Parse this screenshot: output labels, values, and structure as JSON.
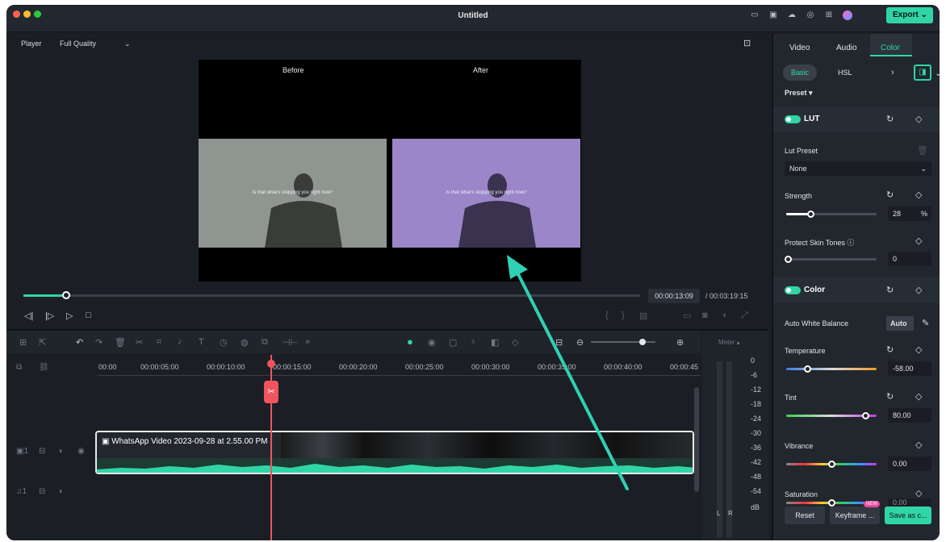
{
  "window": {
    "title": "Untitled",
    "traffic_lights": [
      "#ff5f57",
      "#febc2e",
      "#28c840"
    ]
  },
  "toolbar": {
    "export_label": "Export",
    "icons": [
      "layout-icon",
      "save-icon",
      "cloud-icon",
      "headset-icon",
      "grid-icon",
      "avatar-icon"
    ]
  },
  "player": {
    "label": "Player",
    "quality": "Full Quality",
    "before_label": "Before",
    "after_label": "After",
    "subtitle": "Is that what's stopping you right now?",
    "current_time": "00:00:13:09",
    "total_time": "/ 00:03:19:15",
    "progress": 0.07
  },
  "timeline": {
    "ticks": [
      "00:00",
      "00:00:05:00",
      "00:00:10:00",
      "00:00:15:00",
      "00:00:20:00",
      "00:00:25:00",
      "00:00:30:00",
      "00:00:35:00",
      "00:00:40:00",
      "00:00:45"
    ],
    "clip_title": "WhatsApp Video 2023-09-28 at 2.55.00 PM",
    "meter_title": "Meter",
    "meter_values": [
      "0",
      "-6",
      "-12",
      "-18",
      "-24",
      "-30",
      "-36",
      "-42",
      "-48",
      "-54",
      "dB"
    ],
    "meter_lr": [
      "L",
      "R"
    ]
  },
  "panel": {
    "tabs": [
      "Video",
      "Audio",
      "Color"
    ],
    "active_tab": "Color",
    "subtabs": [
      "Basic",
      "HSL"
    ],
    "preset_label": "Preset",
    "lut_label": "LUT",
    "lut_preset_label": "Lut Preset",
    "lut_preset_value": "None",
    "strength_label": "Strength",
    "strength_value": "28",
    "strength_unit": "%",
    "strength_level": 0.28,
    "skin_label": "Protect Skin Tones",
    "skin_value": "0",
    "color_label": "Color",
    "awb_label": "Auto White Balance",
    "awb_button": "Auto",
    "temperature_label": "Temperature",
    "temperature_value": "-58.00",
    "tint_label": "Tint",
    "tint_value": "80.00",
    "vibrance_label": "Vibrance",
    "vibrance_value": "0.00",
    "saturation_label": "Saturation",
    "saturation_value": "0.00",
    "reset_label": "Reset",
    "keyframe_label": "Keyframe ...",
    "new_badge": "NEW",
    "save_label": "Save as c...",
    "accent": "#30d5a6"
  }
}
